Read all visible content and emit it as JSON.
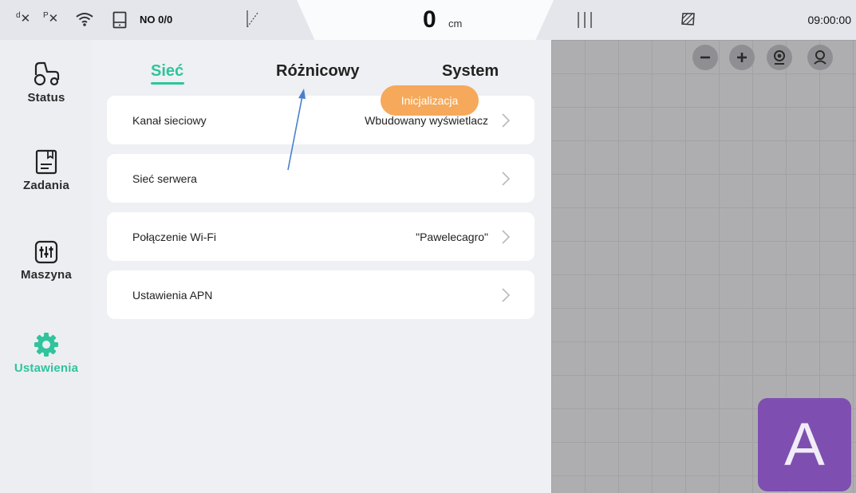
{
  "status_bar": {
    "diff_indicator": "d",
    "pos_indicator": "P",
    "no_label": "NO 0/0",
    "distance_value": "0",
    "distance_unit": "cm",
    "time": "09:00:00"
  },
  "sidebar": {
    "items": [
      {
        "label": "Status",
        "icon": "tractor-icon",
        "active": false
      },
      {
        "label": "Zadania",
        "icon": "task-list-icon",
        "active": false
      },
      {
        "label": "Maszyna",
        "icon": "sliders-icon",
        "active": false
      },
      {
        "label": "Ustawienia",
        "icon": "gear-icon",
        "active": true
      }
    ]
  },
  "tabs": [
    {
      "label": "Sieć",
      "active": true
    },
    {
      "label": "Różnicowy",
      "active": false
    },
    {
      "label": "System",
      "active": false
    }
  ],
  "settings_rows": [
    {
      "label": "Kanał sieciowy",
      "value": "Wbudowany wyświetlacz"
    },
    {
      "label": "Sieć serwera",
      "value": ""
    },
    {
      "label": "Połączenie Wi-Fi",
      "value": "\"Pawelecagro\""
    },
    {
      "label": "Ustawienia APN",
      "value": ""
    }
  ],
  "toast": "Inicjalizacja",
  "map_controls": [
    "zoom-out-icon",
    "zoom-in-icon",
    "locate-icon",
    "user-location-icon"
  ],
  "mode_badge": "A",
  "colors": {
    "accent": "#2fc49c",
    "toast": "#f6a95a",
    "mode_badge": "#7e4fb1",
    "annotation_arrow": "#4a7fd0"
  }
}
